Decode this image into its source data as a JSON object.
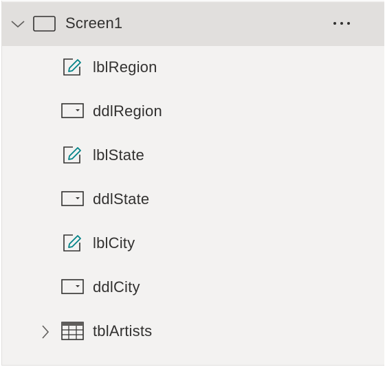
{
  "tree": {
    "screen": {
      "label": "Screen1",
      "expanded": true,
      "icon": "screen-icon",
      "more_icon": "more-options-icon"
    },
    "items": [
      {
        "label": "lblRegion",
        "icon": "label-edit-icon"
      },
      {
        "label": "ddlRegion",
        "icon": "dropdown-icon"
      },
      {
        "label": "lblState",
        "icon": "label-edit-icon"
      },
      {
        "label": "ddlState",
        "icon": "dropdown-icon"
      },
      {
        "label": "lblCity",
        "icon": "label-edit-icon"
      },
      {
        "label": "ddlCity",
        "icon": "dropdown-icon"
      },
      {
        "label": "tblArtists",
        "icon": "table-icon",
        "expandable": true,
        "expanded": false
      }
    ]
  },
  "colors": {
    "panel_bg": "#f3f2f1",
    "header_bg": "#e1dfdd",
    "text": "#323130",
    "pencil_accent": "#038387",
    "icon_stroke": "#323130"
  }
}
